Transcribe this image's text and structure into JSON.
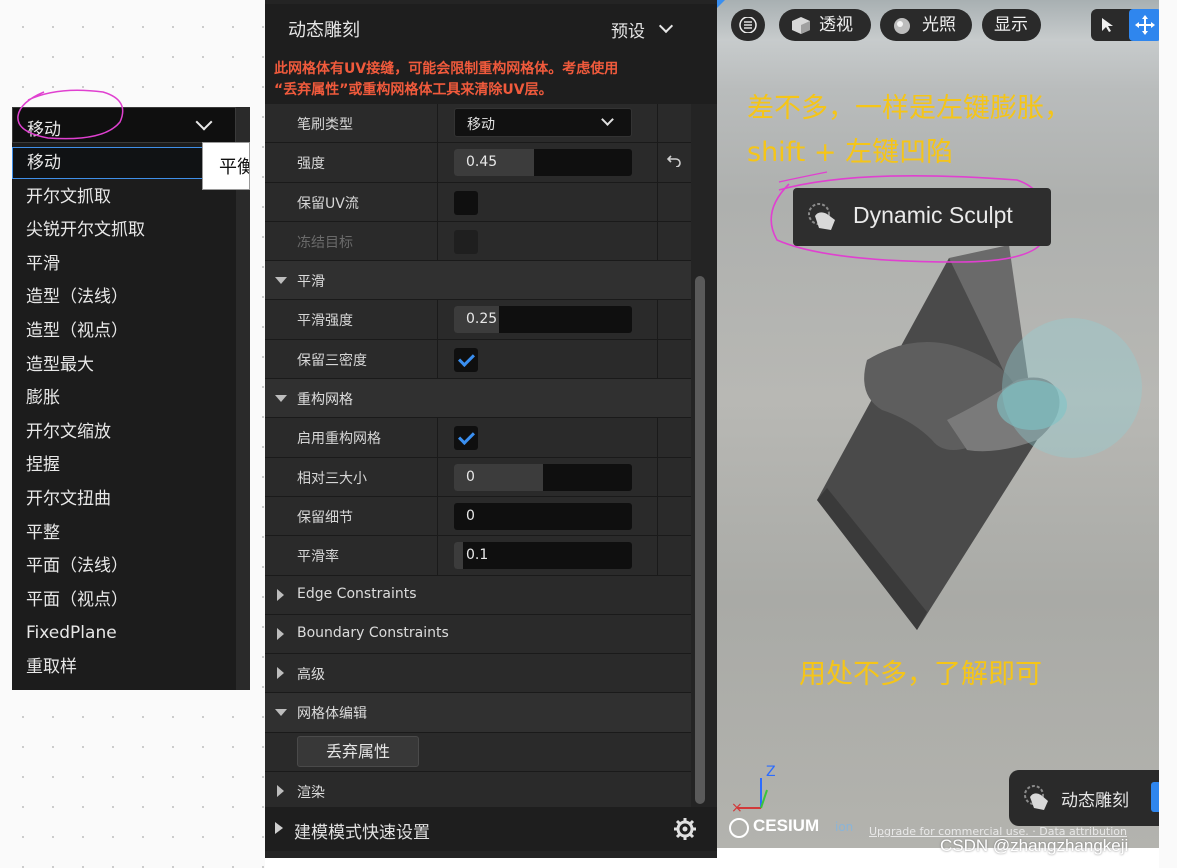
{
  "dropdown": {
    "selected": "移动",
    "tooltip": "平衡",
    "items": [
      "移动",
      "开尔文抓取",
      "尖锐开尔文抓取",
      "平滑",
      "造型（法线）",
      "造型（视点）",
      "造型最大",
      "膨胀",
      "开尔文缩放",
      "捏握",
      "开尔文扭曲",
      "平整",
      "平面（法线）",
      "平面（视点）",
      "FixedPlane",
      "重取样"
    ]
  },
  "panel": {
    "title": "动态雕刻",
    "preset": "预设",
    "warning_line1": "此网格体有UV接缝，可能会限制重构网格体。考虑使用",
    "warning_line2": "“丢弃属性”或重构网格体工具来清除UV层。",
    "brush": {
      "label": "笔刷类型",
      "value": "移动"
    },
    "strength": {
      "label": "强度",
      "value": "0.45",
      "fill": 0.45
    },
    "preserve_uv": {
      "label": "保留UV流",
      "checked": false
    },
    "freeze": {
      "label": "冻结目标",
      "checked": false
    },
    "smooth_section": "平滑",
    "smooth_strength": {
      "label": "平滑强度",
      "value": "0.25",
      "fill": 0.25
    },
    "preserve_tri": {
      "label": "保留三密度",
      "checked": true
    },
    "remesh_section": "重构网格",
    "enable_remesh": {
      "label": "启用重构网格",
      "checked": true
    },
    "rel_tri": {
      "label": "相对三大小",
      "value": "0",
      "fill": 0.5
    },
    "keep_detail": {
      "label": "保留细节",
      "value": "0",
      "fill": 0
    },
    "smooth_rate": {
      "label": "平滑率",
      "value": "0.1",
      "fill": 0.05
    },
    "edge_constraints": "Edge Constraints",
    "boundary_constraints": "Boundary Constraints",
    "advanced": "高级",
    "mesh_edit": "网格体编辑",
    "discard_btn": "丢弃属性",
    "render": "渲染",
    "quick_settings": "建模模式快速设置"
  },
  "viewport": {
    "perspective": "透视",
    "lighting": "光照",
    "show": "显示",
    "annotation1_line1": "差不多，一样是左键膨胀，",
    "annotation1_line2": "shift + 左键凹陷",
    "tool_badge": "Dynamic Sculpt",
    "annotation2": "用处不多，了解即可",
    "mode_badge": "动态雕刻",
    "cesium": "CESIUM",
    "ion": "ion",
    "upgrade": "Upgrade for commercial use. · Data attribution",
    "axis_z": "Z"
  },
  "watermark": "CSDN @zhangzhangkeji",
  "colors": {
    "accent": "#3a8ff0",
    "warning": "#f05a3c",
    "annotation": "#f5c518",
    "circle": "#e040d0"
  }
}
